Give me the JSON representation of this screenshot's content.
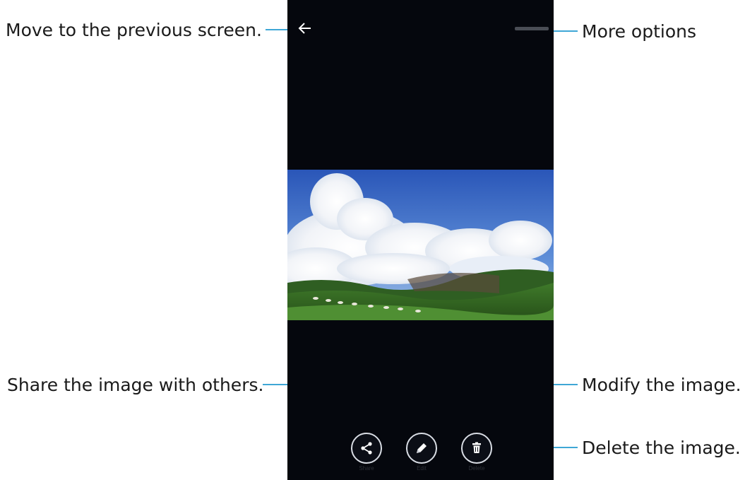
{
  "callouts": {
    "back": "Move to the previous screen.",
    "more": "More options",
    "share": "Share the image with others.",
    "modify": "Modify the image.",
    "delete": "Delete the image."
  },
  "toolbar": {
    "share_label": "Share",
    "edit_label": "Edit",
    "delete_label": "Delete"
  },
  "colors": {
    "callout_line": "#3fa7d6",
    "screen_background": "#05070d",
    "icon_outline": "#d9dde4"
  },
  "icons": {
    "back": "back-arrow-icon",
    "more": "more-options-icon",
    "share": "share-icon",
    "edit": "pencil-icon",
    "delete": "trash-icon"
  }
}
